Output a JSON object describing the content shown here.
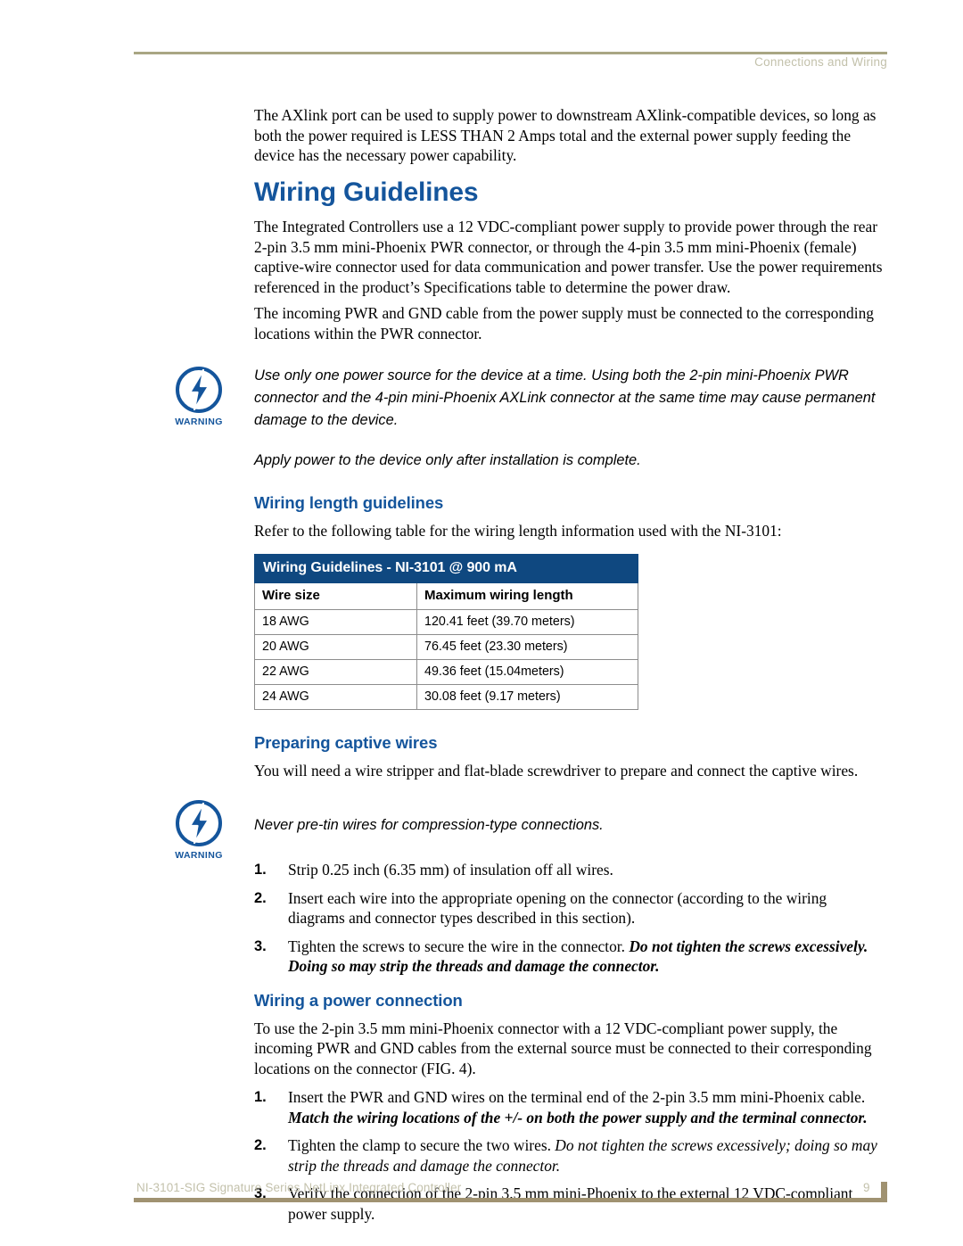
{
  "header": {
    "running_head": "Connections and Wiring"
  },
  "intro": {
    "paragraph": "The AXlink port can be used to supply power to downstream AXlink-compatible devices, so long as both the power required is LESS THAN 2 Amps total and the external power supply feeding the device has the necessary power capability."
  },
  "section": {
    "title": "Wiring Guidelines",
    "paragraph_1": "The Integrated Controllers use a 12 VDC-compliant power supply to provide power through the rear 2-pin 3.5 mm mini-Phoenix PWR connector, or through the 4-pin 3.5 mm mini-Phoenix (female) captive-wire connector used for data communication and power transfer. Use the power requirements referenced in the product’s Specifications table to determine the power draw.",
    "paragraph_2": "The incoming PWR and GND cable from the power supply must be connected to the corresponding locations within the PWR connector."
  },
  "warning_1": {
    "label": "WARNING",
    "icon": "lightning-bolt-warning-icon",
    "line_1": "Use only one power source for the device at a time. Using both the 2-pin mini-Phoenix PWR connector and the 4-pin mini-Phoenix AXLink connector at the same time may cause permanent damage to the device.",
    "line_2": "Apply power to the device only after installation is complete."
  },
  "wiring_length": {
    "heading": "Wiring length guidelines",
    "intro": "Refer to the following table for the wiring length information used with the NI-3101:",
    "table": {
      "caption": "Wiring Guidelines - NI-3101 @ 900 mA",
      "columns": [
        "Wire size",
        "Maximum wiring length"
      ],
      "rows": [
        [
          "18 AWG",
          "120.41 feet (39.70 meters)"
        ],
        [
          "20 AWG",
          "76.45 feet (23.30 meters)"
        ],
        [
          "22 AWG",
          "49.36 feet (15.04meters)"
        ],
        [
          "24 AWG",
          "30.08 feet (9.17 meters)"
        ]
      ]
    }
  },
  "preparing": {
    "heading": "Preparing captive wires",
    "intro": "You will need a wire stripper and flat-blade screwdriver to prepare and connect the captive wires."
  },
  "warning_2": {
    "label": "WARNING",
    "icon": "lightning-bolt-warning-icon",
    "line_1": "Never pre-tin wires for compression-type connections."
  },
  "prep_steps": [
    {
      "num": "1.",
      "text": "Strip 0.25 inch (6.35 mm) of insulation off all wires."
    },
    {
      "num": "2.",
      "text": "Insert each wire into the appropriate opening on the connector (according to the wiring diagrams and connector types described in this section)."
    },
    {
      "num": "3.",
      "text": "Tighten the screws to secure the wire in the connector. ",
      "emphasis": "Do not tighten the screws excessively. Doing so may strip the threads and damage the connector."
    }
  ],
  "power_connection": {
    "heading": "Wiring a power connection",
    "intro": "To use the 2-pin 3.5 mm mini-Phoenix connector with a 12 VDC-compliant power supply, the incoming PWR and GND cables from the external source must be connected to their corresponding locations on the connector (FIG. 4)."
  },
  "power_steps": [
    {
      "num": "1.",
      "text": "Insert the PWR and GND wires on the terminal end of the 2-pin 3.5 mm mini-Phoenix cable. ",
      "emphasis": "Match the wiring locations of the +/- on both the power supply and the terminal connector."
    },
    {
      "num": "2.",
      "text": "Tighten the clamp to secure the two wires. ",
      "emphasis": "Do not tighten the screws excessively; doing so may strip the threads and damage the connector."
    },
    {
      "num": "3.",
      "text": "Verify the connection of the 2-pin 3.5 mm mini-Phoenix to the external 12 VDC-compliant power supply."
    }
  ],
  "footer": {
    "document_title": "NI-3101-SIG Signature Series NetLinx Integrated Controller",
    "page_number": "9"
  },
  "colors": {
    "heading_blue": "#14559c",
    "table_header_blue": "#0f4880",
    "rule_khaki": "#a9a683",
    "footer_rule": "#a09271",
    "muted_text": "#c3c1ab"
  }
}
